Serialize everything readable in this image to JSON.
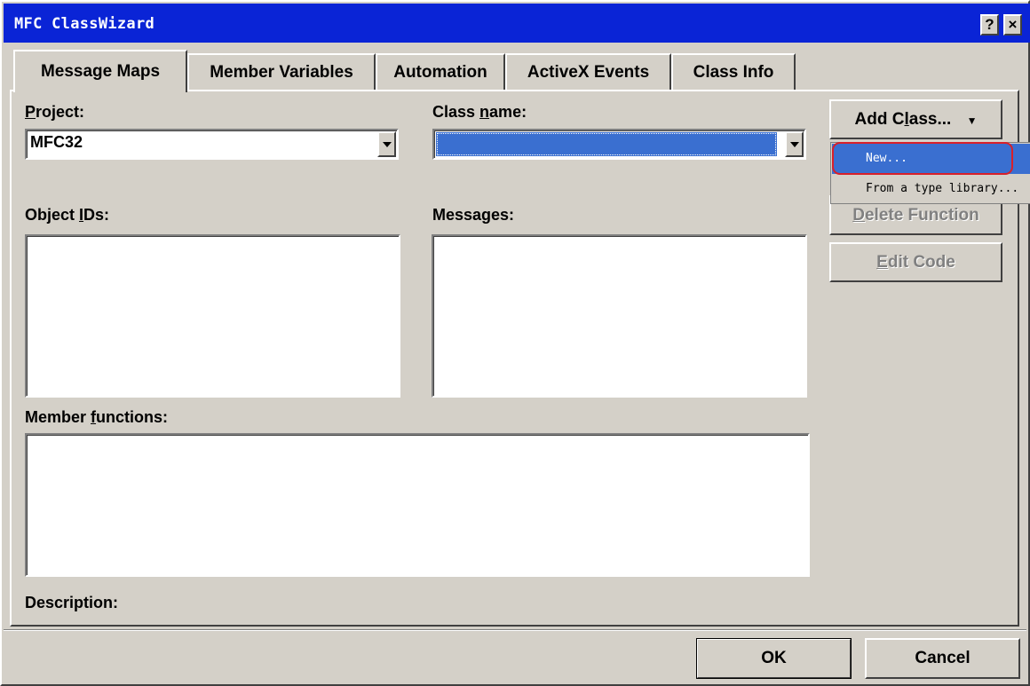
{
  "window": {
    "title": "MFC ClassWizard",
    "help_label": "?",
    "close_label": "×"
  },
  "tabs": [
    {
      "label": "Message Maps",
      "active": true
    },
    {
      "label": "Member Variables",
      "active": false
    },
    {
      "label": "Automation",
      "active": false
    },
    {
      "label": "ActiveX Events",
      "active": false
    },
    {
      "label": "Class Info",
      "active": false
    }
  ],
  "project": {
    "label_key": "P",
    "label_rest": "roject:",
    "value": "MFC32"
  },
  "class_name": {
    "label_pre": "Class ",
    "label_key": "n",
    "label_rest": "ame:",
    "value": ""
  },
  "object_ids": {
    "label_pre": "Object ",
    "label_key": "I",
    "label_rest": "Ds:"
  },
  "messages": {
    "label": "Messages:"
  },
  "member_functions": {
    "label_pre": "Member ",
    "label_key": "f",
    "label_rest": "unctions:"
  },
  "description": {
    "label": "Description:"
  },
  "buttons": {
    "add_class_pre": "Add C",
    "add_class_key": "l",
    "add_class_rest": "ass...",
    "add_class_arrow": "▼",
    "delete_function_key": "D",
    "delete_function_rest": "elete Function",
    "edit_code_key": "E",
    "edit_code_rest": "dit Code",
    "ok": "OK",
    "cancel": "Cancel"
  },
  "add_class_menu": {
    "items": [
      "New...",
      "From a type library..."
    ]
  },
  "colors": {
    "face": "#d4d0c8",
    "titlebar": "#0a24d6",
    "selection": "#3a6fd0",
    "highlight_ring": "#d8202a"
  }
}
